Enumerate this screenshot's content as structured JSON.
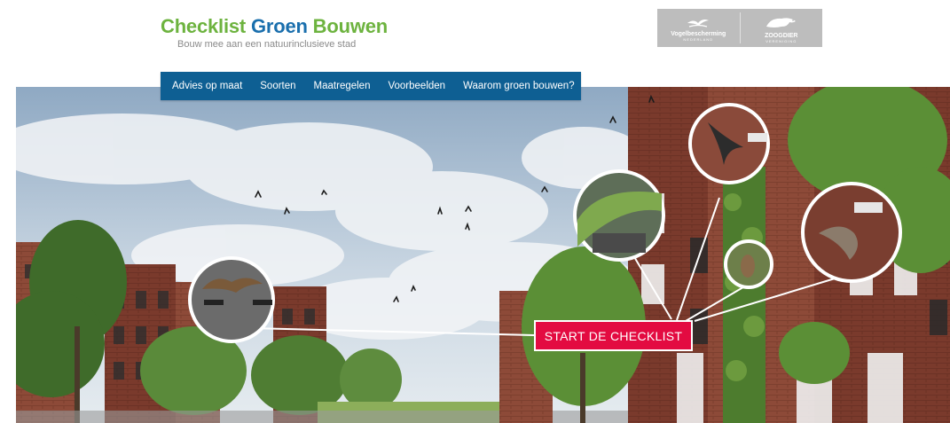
{
  "header": {
    "logo": {
      "word1": "Checklist",
      "word2": "Groen",
      "word3": "Bouwen",
      "tagline": "Bouw mee aan een natuurinclusieve stad"
    },
    "partners": [
      {
        "name": "Vogelbescherming",
        "sub": "NEDERLAND",
        "icon": "bird-logo-icon"
      },
      {
        "name": "ZOOGDIER",
        "sub": "VERENIGING",
        "icon": "otter-logo-icon"
      }
    ]
  },
  "nav": {
    "items": [
      "Advies op maat",
      "Soorten",
      "Maatregelen",
      "Voorbeelden",
      "Waarom groen bouwen?"
    ]
  },
  "hero": {
    "cta_label": "START DE CHECKLIST"
  },
  "colors": {
    "nav_bg": "#0e5f93",
    "cta_bg": "#e30b41",
    "logo_green": "#6db33f",
    "logo_blue": "#1a6fad"
  }
}
